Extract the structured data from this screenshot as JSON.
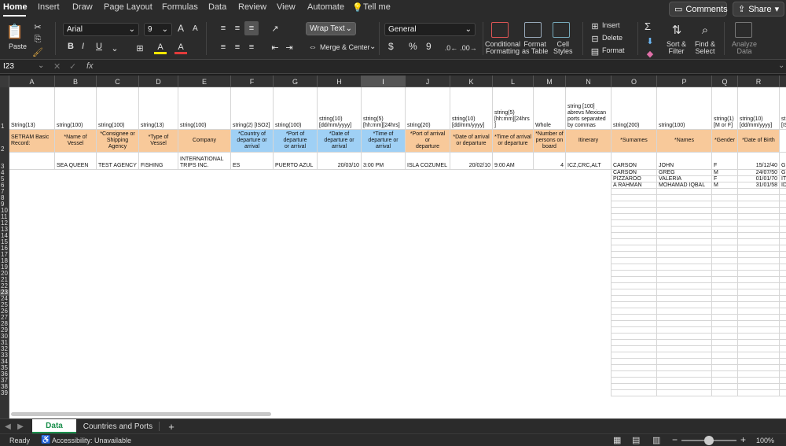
{
  "ribbon_tabs": [
    "Home",
    "Insert",
    "Draw",
    "Page Layout",
    "Formulas",
    "Data",
    "Review",
    "View",
    "Automate",
    "Tell me"
  ],
  "header_buttons": {
    "comments": "Comments",
    "share": "Share"
  },
  "font": {
    "name": "Arial",
    "size": "9"
  },
  "paste_label": "Paste",
  "bold": "B",
  "italic": "I",
  "underline": "U",
  "font_color_letter": "A",
  "highlight_letter": "A",
  "font_grow": "A",
  "font_shrink": "A",
  "wrap_text": "Wrap Text",
  "merge_center": "Merge & Center",
  "number_format": "General",
  "currency_symbol": "$",
  "percent_symbol": "%",
  "comma_symbol": "9",
  "styles": [
    {
      "label": "Conditional\nFormatting"
    },
    {
      "label": "Format\nas Table"
    },
    {
      "label": "Cell\nStyles"
    }
  ],
  "cells_group": {
    "insert": "Insert",
    "delete": "Delete",
    "format": "Format"
  },
  "sigma": "Σ",
  "sort_filter": "Sort &\nFilter",
  "find_select": "Find &\nSelect",
  "analyze_data": "Analyze\nData",
  "name_box": "I23",
  "fx": "fx",
  "formula_value": "",
  "columns": [
    "A",
    "B",
    "C",
    "D",
    "E",
    "F",
    "G",
    "H",
    "I",
    "J",
    "K",
    "L",
    "M",
    "N",
    "O",
    "P",
    "Q",
    "R",
    "S"
  ],
  "selected_column": "I",
  "rows": [
    "1",
    "2",
    "3",
    "4",
    "5",
    "6",
    "7",
    "8",
    "9",
    "10",
    "11",
    "12",
    "13",
    "14",
    "15",
    "16",
    "17",
    "18",
    "19",
    "20",
    "21",
    "22",
    "23",
    "24",
    "25",
    "26",
    "27",
    "28",
    "29",
    "30",
    "31",
    "32",
    "33",
    "34",
    "35",
    "36",
    "37",
    "38",
    "39"
  ],
  "row1": [
    "String(13)",
    "string(100)",
    "string(100)",
    "string(13)",
    "string(100)",
    "string(2) [ISO2]",
    "string(100)",
    "string(10)\n[dd/mm/yyyy]",
    "string(5)\n[hh:mm][24hrs]",
    "string(20)",
    "string(10)\n[dd/mm/yyyy]",
    "string(5)\n[hh:mm][24hrs\n]",
    "Whole",
    "string [100]\nabrevs Mexican\nports separated\nby commas",
    "string(200)",
    "string(100)",
    "string(1)\n[M or F]",
    "string(10)\n[dd/mm/yyyy]",
    "st\n[IS"
  ],
  "row2": [
    "SETRAM Basic\nRecord:",
    "*Name of\nVessel",
    "*Consignee or\nShipping Agency",
    "*Type of Vessel",
    "Company",
    "*Country of\ndeparture or\narrival",
    "*Port of departure\nor arrival",
    "*Date of\ndeparture or\narrival",
    "*Time of\ndeparture or\narrival",
    "*Port of arrival or\ndeparture",
    "*Date of arrival\nor departure",
    "*Time of arrival\nor departure",
    "*Number of\npersons on\nboard",
    "Itinerary",
    "*Surnames",
    "*Names",
    "*Gender",
    "*Date of Birth",
    ""
  ],
  "row3": [
    "",
    "SEA QUEEN",
    "TEST AGENCY",
    "FISHING",
    "INTERNATIONAL\nTRIPS INC.",
    "ES",
    "PUERTO AZUL",
    "20/03/10",
    "3:00 PM",
    "ISLA COZUMEL",
    "20/02/10",
    "9:00 AM",
    "4",
    "ICZ,CRC,ALT",
    "CARSON",
    "JOHN",
    "F",
    "15/12/40",
    "GB"
  ],
  "row4": {
    "O": "CARSON",
    "P": "GREG",
    "Q": "M",
    "R": "24/07/50",
    "S": "GB"
  },
  "row5": {
    "O": "PIZZAROO",
    "P": "VALERIA",
    "Q": "F",
    "R": "01/01/70",
    "S": "IT"
  },
  "row6": {
    "O": "A RAHMAN",
    "P": "MOHAMAD IQBAL",
    "Q": "M",
    "R": "31/01/58",
    "S": "ID"
  },
  "sheets": [
    "Data",
    "Countries and Ports"
  ],
  "add_sheet": "+",
  "status": {
    "ready": "Ready",
    "accessibility": "Accessibility: Unavailable",
    "zoom": "100%"
  },
  "colors": {
    "orange": "#f8c99a",
    "blue": "#9fd0f5",
    "active_tab_green": "#1a8f4c"
  }
}
